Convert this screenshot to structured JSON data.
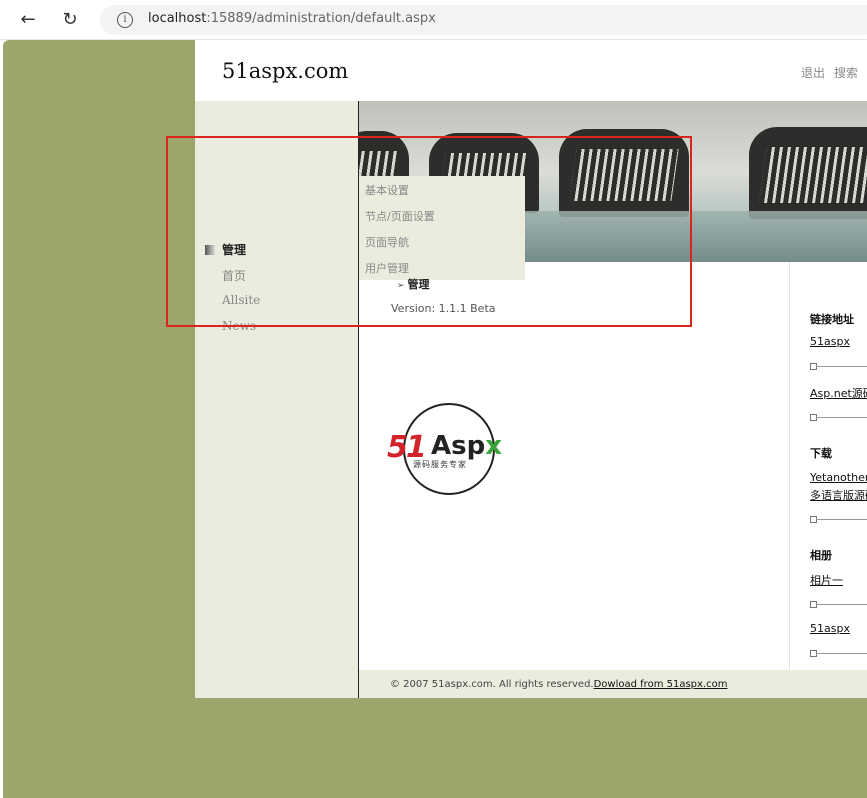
{
  "browser": {
    "back_icon": "←",
    "reload_icon": "↻",
    "info_icon": "i",
    "url_host": "localhost",
    "url_rest": ":15889/administration/default.aspx"
  },
  "header": {
    "logo": "51aspx.com",
    "links": [
      "退出",
      "搜索"
    ]
  },
  "nav": {
    "items": [
      {
        "label": "管理",
        "active": true
      },
      {
        "label": "首页"
      },
      {
        "label": "Allsite"
      },
      {
        "label": "News"
      }
    ]
  },
  "submenu": {
    "items": [
      "基本设置",
      "节点/页面设置",
      "页面导航",
      "用户管理"
    ]
  },
  "content": {
    "heading": "管理",
    "version": "Version: 1.1.1 Beta"
  },
  "badge": {
    "part1": "51",
    "part2": "Asp",
    "part3": "x",
    "tagline": "源码服务专家"
  },
  "right": {
    "sections": [
      {
        "title": "链接地址",
        "links": [
          "51aspx",
          "Asp.net源码"
        ]
      },
      {
        "title": "下载",
        "links": [
          "Yetanotherforum",
          "多语言版源码"
        ]
      },
      {
        "title": "相册",
        "links": [
          "相片一",
          "51aspx"
        ]
      }
    ]
  },
  "footer": {
    "copyright": "© 2007 51aspx.com. All rights reserved.",
    "link": "Dowload from 51aspx.com"
  },
  "colors": {
    "page_bg": "#9ea56c",
    "sidebar_bg": "#ebebde",
    "highlight": "#d8251e"
  }
}
